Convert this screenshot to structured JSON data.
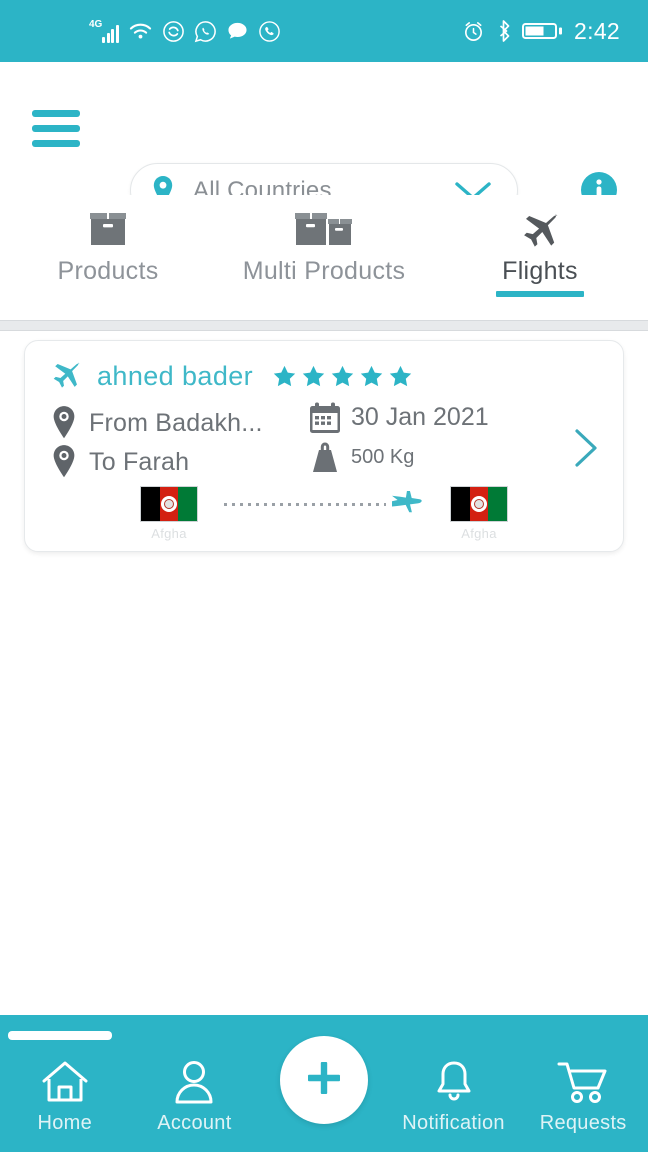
{
  "theme": {
    "accent": "#2cb4c6",
    "accent_light": "#3fb8c8",
    "text_gray": "#6d7277",
    "text_muted": "#8e9399",
    "card_bg": "#ffffff"
  },
  "status_bar": {
    "network_label": "4G",
    "time": "2:42",
    "left_icons": [
      "signal-bars-icon",
      "wifi-icon",
      "sync-icon",
      "whatsapp-icon",
      "chat-bubble-icon",
      "phone-circle-icon"
    ],
    "right_icons": [
      "alarm-icon",
      "bluetooth-icon",
      "battery-icon"
    ]
  },
  "header": {
    "menu_icon": "hamburger-icon",
    "country_selector": {
      "pin_icon": "location-pin-icon",
      "value": "All Countries",
      "chevron_icon": "chevron-down-icon"
    },
    "info_icon": "info-icon"
  },
  "tabs": [
    {
      "label": "Products",
      "icon": "box-icon",
      "active": false
    },
    {
      "label": "Multi Products",
      "icon": "multi-box-icon",
      "active": false
    },
    {
      "label": "Flights",
      "icon": "airplane-icon",
      "active": true
    }
  ],
  "flight_card": {
    "traveler_icon": "airplane-icon",
    "traveler_name": "ahned bader",
    "rating": 5,
    "rating_max": 5,
    "from_label": "From Badakh...",
    "to_label": "To Farah",
    "date_icon": "calendar-icon",
    "date": "30 Jan 2021",
    "weight_icon": "weight-icon",
    "weight": "500 Kg",
    "chevron_icon": "chevron-right-icon",
    "route": {
      "origin_flag": "afghanistan-flag",
      "origin_label": "Afgha",
      "destination_flag": "afghanistan-flag",
      "destination_label": "Afgha",
      "transit_icon": "airplane-icon"
    }
  },
  "bottom_nav": {
    "items": [
      {
        "label": "Home",
        "icon": "home-icon"
      },
      {
        "label": "Account",
        "icon": "person-icon"
      },
      {
        "label": "Notification",
        "icon": "bell-icon"
      },
      {
        "label": "Requests",
        "icon": "shopping-cart-icon"
      }
    ],
    "fab_icon": "plus-icon"
  }
}
